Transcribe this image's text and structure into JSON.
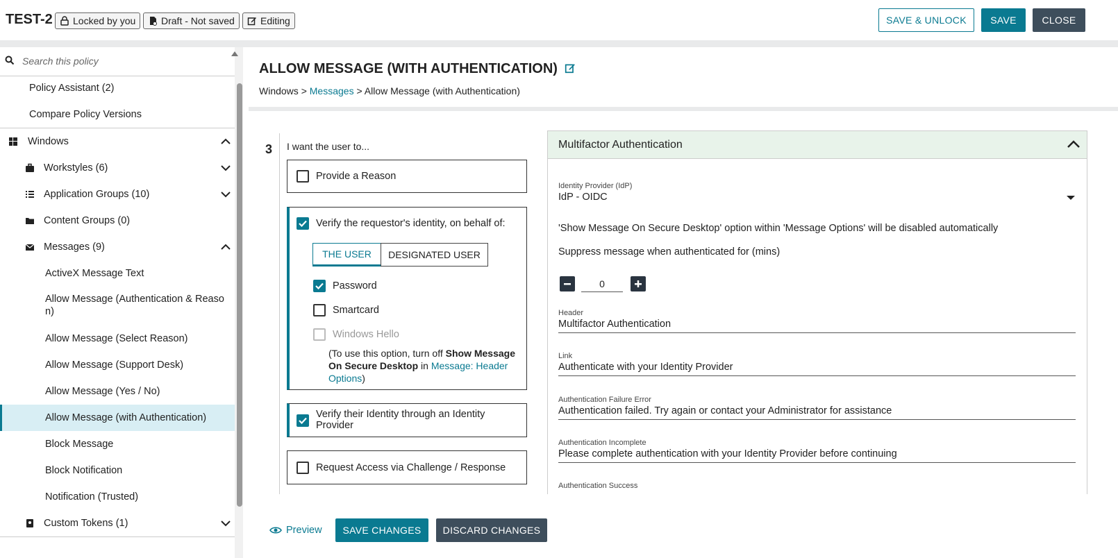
{
  "header": {
    "policy_name": "TEST-2",
    "badges": [
      "Locked by you",
      "Draft - Not saved",
      "Editing"
    ],
    "save_unlock_label": "SAVE & UNLOCK",
    "save_label": "SAVE",
    "close_label": "CLOSE"
  },
  "sidebar": {
    "search_placeholder": "Search this policy",
    "policy_assistant": "Policy Assistant (2)",
    "compare_versions": "Compare Policy Versions",
    "windows": "Windows",
    "groups": [
      {
        "label": "Workstyles (6)",
        "icon": "briefcase-icon"
      },
      {
        "label": "Application Groups (10)",
        "icon": "list-icon"
      },
      {
        "label": "Content Groups (0)",
        "icon": "folder-icon"
      },
      {
        "label": "Messages (9)",
        "icon": "envelope-icon"
      }
    ],
    "messages": [
      "ActiveX Message Text",
      "Allow Message (Authentication & Reaso",
      "n)",
      "Allow Message (Select Reason)",
      "Allow Message (Support Desk)",
      "Allow Message (Yes / No)",
      "Allow Message (with Authentication)",
      "Block Message",
      "Block Notification",
      "Notification (Trusted)"
    ],
    "custom_tokens": "Custom Tokens (1)"
  },
  "main": {
    "title": "ALLOW MESSAGE (WITH AUTHENTICATION)",
    "breadcrumb_root": "Windows",
    "breadcrumb_link": "Messages",
    "breadcrumb_sep": ">",
    "breadcrumb_current": "Allow Message (with Authentication)",
    "step_number": "3",
    "intro": "I want the user to...",
    "opt_reason": "Provide a Reason",
    "opt_verify": "Verify the requestor's identity, on behalf of:",
    "seg_user": "THE USER",
    "seg_designated": "DESIGNATED USER",
    "opt_password": "Password",
    "opt_smartcard": "Smartcard",
    "opt_hello": "Windows Hello",
    "note_pre": "(To use this option, turn off ",
    "note_bold1": "Show Message",
    "note_bold2": "On Secure Desktop",
    "note_in": " in ",
    "note_link1": "Message: Header",
    "note_link2": "Options",
    "note_end": ")",
    "opt_idp_line1": "Verify their Identity through an Identity",
    "opt_idp_line2": "Provider",
    "opt_challenge": "Request Access via Challenge / Response"
  },
  "mfa": {
    "title": "Multifactor Authentication",
    "idp_label": "Identity Provider (IdP)",
    "idp_value": "IdP - OIDC",
    "info": "'Show Message On Secure Desktop' option within 'Message Options' will be disabled automatically",
    "suppress_label": "Suppress message when authenticated for (mins)",
    "suppress_value": "0",
    "header_label": "Header",
    "header_value": "Multifactor Authentication",
    "link_label": "Link",
    "link_value": "Authenticate with your Identity Provider",
    "fail_label": "Authentication Failure Error",
    "fail_value": "Authentication failed. Try again or contact your Administrator for assistance",
    "incomplete_label": "Authentication Incomplete",
    "incomplete_value": "Please complete authentication with your Identity Provider before continuing",
    "success_label": "Authentication Success"
  },
  "footer": {
    "preview": "Preview",
    "save_changes": "SAVE CHANGES",
    "discard_changes": "DISCARD CHANGES"
  },
  "colors": {
    "accent": "#0a7a91",
    "dark_button": "#3e4e5c",
    "selected_bg": "#d8eef4",
    "panel_header_bg": "#e8f3ea"
  }
}
